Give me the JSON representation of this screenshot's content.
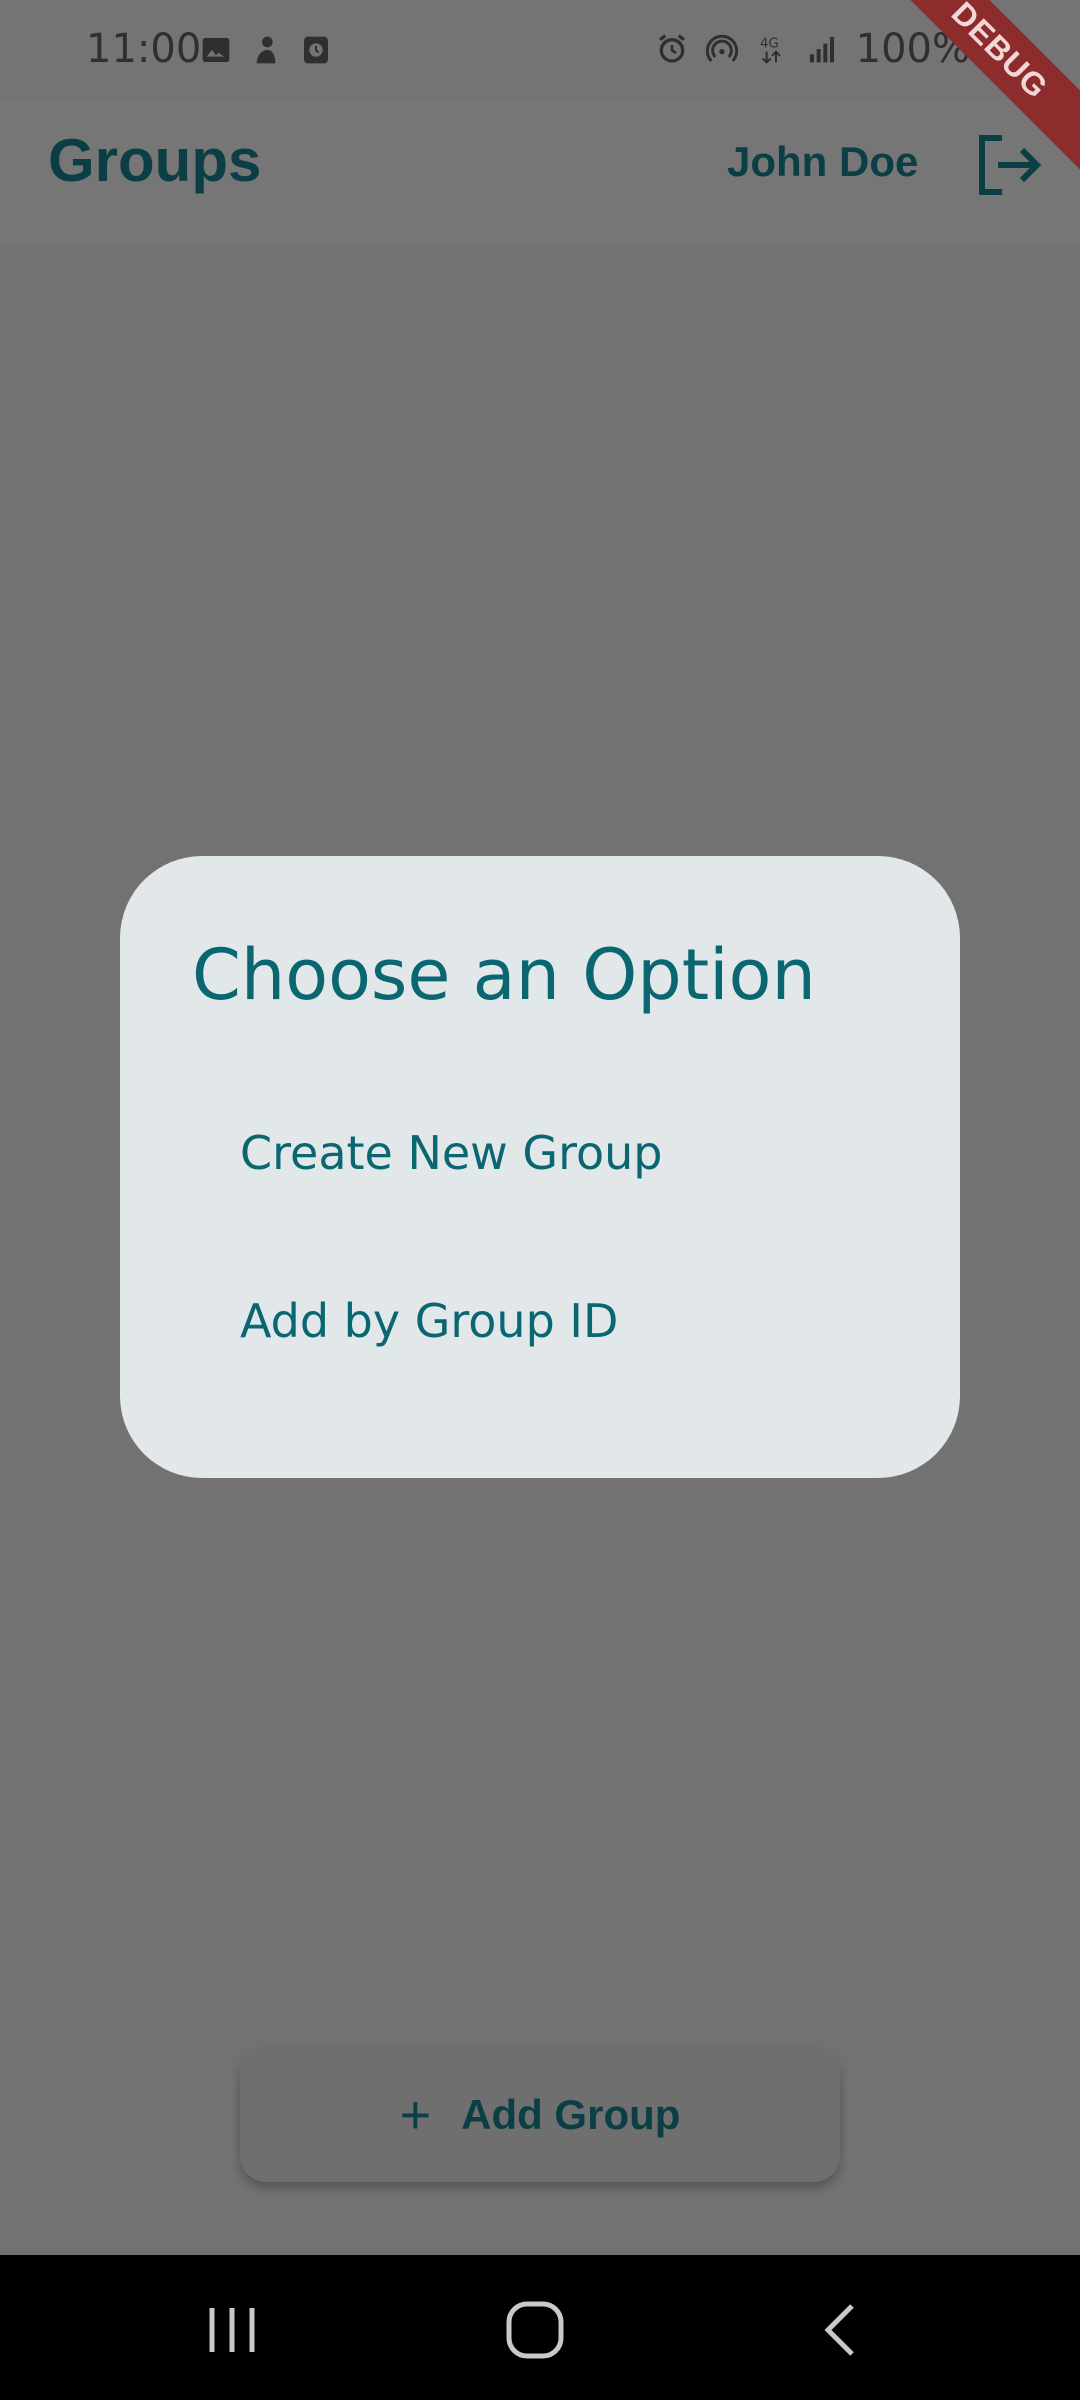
{
  "status_bar": {
    "time": "11:00",
    "battery": "100%",
    "left_icons": [
      "image-icon",
      "person-icon",
      "alarm-square-icon"
    ],
    "right_icons": [
      "alarm-icon",
      "hotspot-icon",
      "network-4g-icon",
      "signal-icon",
      "battery-icon"
    ]
  },
  "app_bar": {
    "title": "Groups",
    "user_name": "John Doe",
    "logout_icon": "logout-icon"
  },
  "debug_banner": "DEBUG",
  "dialog": {
    "title": "Choose an Option",
    "options": [
      {
        "label": "Create New Group"
      },
      {
        "label": "Add by Group ID"
      }
    ]
  },
  "add_group_button": {
    "label": "Add Group",
    "icon": "plus-icon"
  },
  "nav_bar": {
    "buttons": [
      "recents-icon",
      "home-icon",
      "back-icon"
    ]
  },
  "colors": {
    "accent": "#0a6670",
    "dark_accent": "#0b3f45",
    "scrim": "#727272",
    "dialog_bg": "#e2e7ea"
  }
}
